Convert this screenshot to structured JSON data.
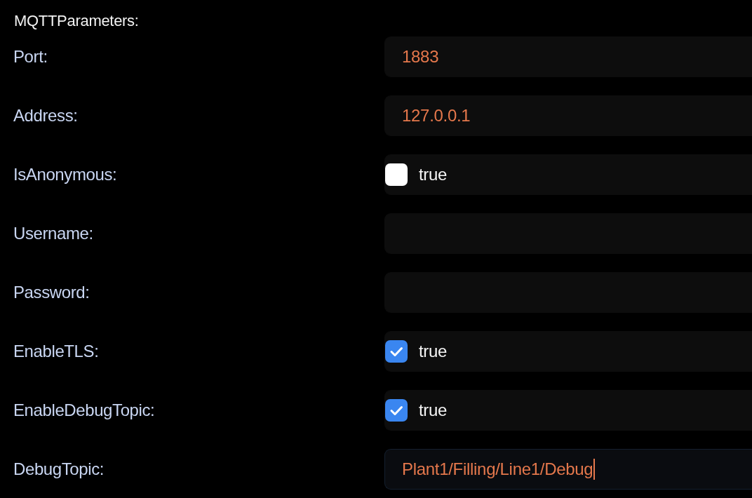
{
  "section": {
    "title": "MQTTParameters:"
  },
  "fields": [
    {
      "label": "Port:",
      "kind": "text",
      "value": "1883",
      "focused": false
    },
    {
      "label": "Address:",
      "kind": "text",
      "value": "127.0.0.1",
      "focused": false
    },
    {
      "label": "IsAnonymous:",
      "kind": "checkbox",
      "checked": false,
      "text": "true",
      "focused": false
    },
    {
      "label": "Username:",
      "kind": "text",
      "focused": false
    },
    {
      "label": "Password:",
      "kind": "text",
      "focused": false
    },
    {
      "label": "EnableTLS:",
      "kind": "checkbox",
      "checked": true,
      "text": "true",
      "focused": false
    },
    {
      "label": "EnableDebugTopic:",
      "kind": "checkbox",
      "checked": true,
      "text": "true",
      "focused": false
    },
    {
      "label": "DebugTopic:",
      "kind": "text",
      "value": "Plant1/Filling/Line1/Debug",
      "focused": true
    }
  ]
}
